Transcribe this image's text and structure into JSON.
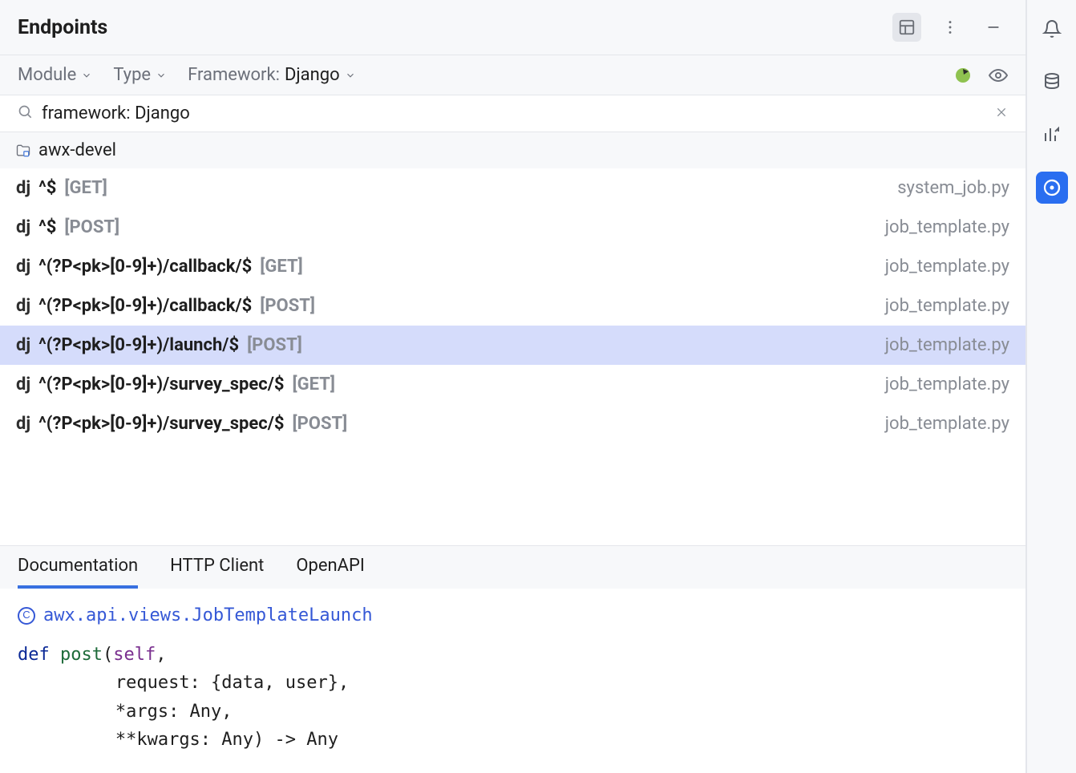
{
  "header": {
    "title": "Endpoints"
  },
  "filters": {
    "module_label": "Module",
    "type_label": "Type",
    "framework_label": "Framework:",
    "framework_value": "Django"
  },
  "search": {
    "value": "framework: Django"
  },
  "project": {
    "name": "awx-devel"
  },
  "endpoints": [
    {
      "badge": "dj",
      "path": "^$",
      "method": "[GET]",
      "file": "system_job.py",
      "selected": false
    },
    {
      "badge": "dj",
      "path": "^$",
      "method": "[POST]",
      "file": "job_template.py",
      "selected": false
    },
    {
      "badge": "dj",
      "path": "^(?P<pk>[0-9]+)/callback/$",
      "method": "[GET]",
      "file": "job_template.py",
      "selected": false
    },
    {
      "badge": "dj",
      "path": "^(?P<pk>[0-9]+)/callback/$",
      "method": "[POST]",
      "file": "job_template.py",
      "selected": false
    },
    {
      "badge": "dj",
      "path": "^(?P<pk>[0-9]+)/launch/$",
      "method": "[POST]",
      "file": "job_template.py",
      "selected": true
    },
    {
      "badge": "dj",
      "path": "^(?P<pk>[0-9]+)/survey_spec/$",
      "method": "[GET]",
      "file": "job_template.py",
      "selected": false
    },
    {
      "badge": "dj",
      "path": "^(?P<pk>[0-9]+)/survey_spec/$",
      "method": "[POST]",
      "file": "job_template.py",
      "selected": false
    }
  ],
  "tabs": [
    {
      "label": "Documentation",
      "active": true
    },
    {
      "label": "HTTP Client",
      "active": false
    },
    {
      "label": "OpenAPI",
      "active": false
    }
  ],
  "doc": {
    "class_ref": "awx.api.views.JobTemplateLaunch",
    "def_kw": "def ",
    "fn_name": "post",
    "self_kw": "self",
    "line1_open": "(",
    "line1_end": ",",
    "line2": "request: {data, user},",
    "line3": "*args: Any,",
    "line4": "**kwargs: Any) -> Any",
    "copyright_glyph": "C"
  }
}
